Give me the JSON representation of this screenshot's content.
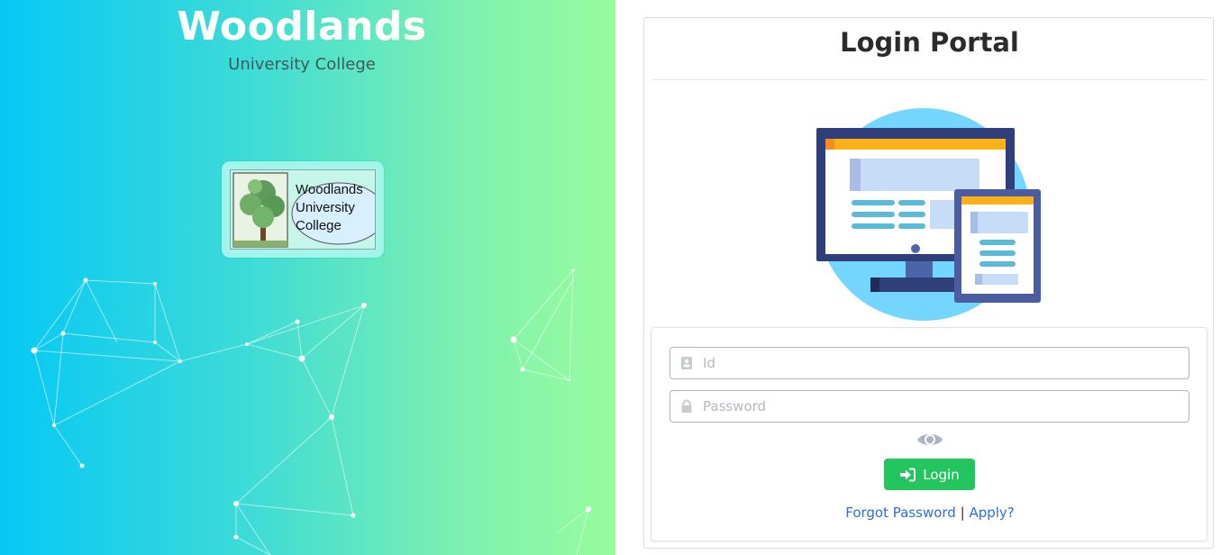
{
  "brand": {
    "title": "Woodlands",
    "subtitle": "University College",
    "logo_text": [
      "Woodlands",
      "University",
      "College"
    ]
  },
  "portal": {
    "title": "Login Portal"
  },
  "form": {
    "id_placeholder": "Id",
    "id_value": "",
    "password_placeholder": "Password",
    "password_value": "",
    "id_icon": "id-card-icon",
    "password_icon": "lock-icon",
    "toggle_icon": "eye-icon",
    "login_label": "Login",
    "login_icon": "sign-in-icon",
    "forgot_label": "Forgot Password",
    "separator": "|",
    "apply_label": "Apply?"
  },
  "colors": {
    "gradient_start": "#06c8f5",
    "gradient_end": "#98fc9c",
    "login_button": "#22c55e",
    "link": "#2f6fd0"
  }
}
